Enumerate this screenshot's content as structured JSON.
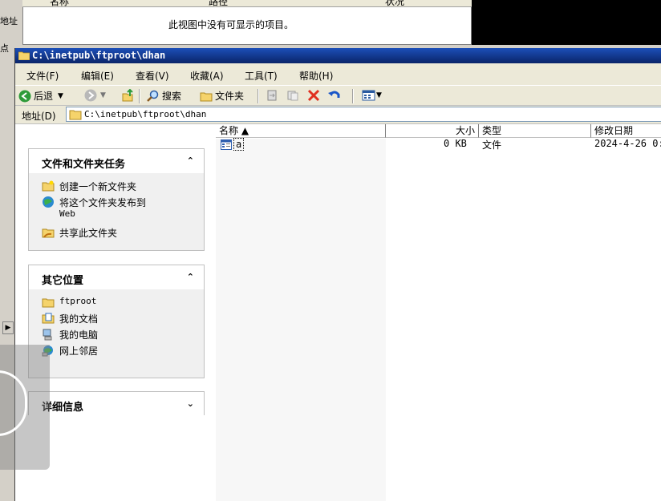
{
  "background_window": {
    "col_name": "名称",
    "col_path": "路径",
    "col_status": "状况",
    "empty_message": "此视图中没有可显示的项目。",
    "left_fragment_addr": "地址",
    "left_fragment_pt": "点"
  },
  "window": {
    "title": "C:\\inetpub\\ftproot\\dhan"
  },
  "menu": [
    "文件(F)",
    "编辑(E)",
    "查看(V)",
    "收藏(A)",
    "工具(T)",
    "帮助(H)"
  ],
  "toolbar": {
    "back": "后退",
    "search": "搜索",
    "folders": "文件夹"
  },
  "address": {
    "label": "地址(D)",
    "value": "C:\\inetpub\\ftproot\\dhan"
  },
  "tasks_panel": {
    "title": "文件和文件夹任务",
    "chevron": "⌃",
    "items": [
      {
        "label": "创建一个新文件夹",
        "icon": "new-folder-icon"
      },
      {
        "label": "将这个文件夹发布到",
        "label2": "Web",
        "icon": "publish-web-icon"
      },
      {
        "label": "共享此文件夹",
        "icon": "share-folder-icon"
      }
    ]
  },
  "places_panel": {
    "title": "其它位置",
    "chevron": "⌃",
    "items": [
      {
        "label": "ftproot",
        "icon": "folder-icon"
      },
      {
        "label": "我的文档",
        "icon": "my-documents-icon"
      },
      {
        "label": "我的电脑",
        "icon": "my-computer-icon"
      },
      {
        "label": "网上邻居",
        "icon": "network-places-icon"
      }
    ]
  },
  "details_panel": {
    "title": "详细信息",
    "chevron": "⌄"
  },
  "file_list": {
    "columns": [
      "名称 ▲",
      "大小",
      "类型",
      "修改日期"
    ],
    "rows": [
      {
        "name": "a",
        "size": "0 KB",
        "type": "文件",
        "modified": "2024-4-26 0:"
      }
    ]
  },
  "colors": {
    "title_bar": "#0a246a",
    "window_bg": "#ece9d8",
    "close_x": "#e03020"
  }
}
